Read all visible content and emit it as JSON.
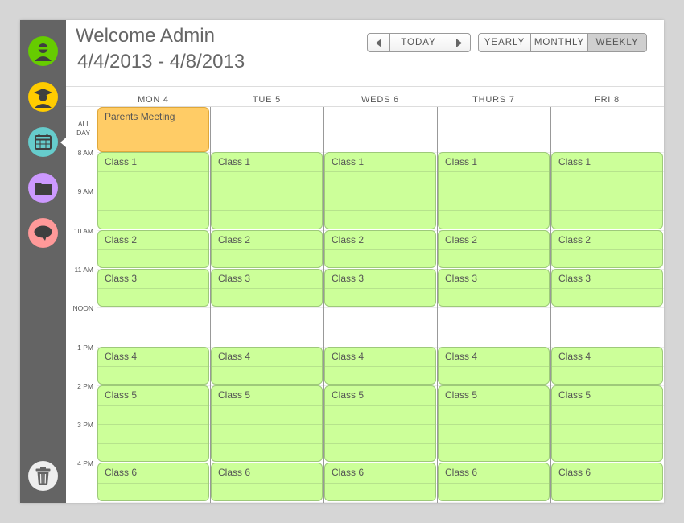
{
  "header": {
    "title": "Welcome Admin",
    "date_range": "4/4/2013 - 4/8/2013"
  },
  "nav": {
    "prev_icon": "triangle-left",
    "today_label": "TODAY",
    "next_icon": "triangle-right"
  },
  "views": [
    {
      "label": "YEARLY",
      "active": false
    },
    {
      "label": "MONTHLY",
      "active": false
    },
    {
      "label": "WEEKLY",
      "active": true
    }
  ],
  "sidebar": {
    "items": [
      {
        "icon": "user-icon",
        "color": "#66cc00"
      },
      {
        "icon": "graduate-icon",
        "color": "#ffcc00"
      },
      {
        "icon": "calendar-icon",
        "color": "#66cccc",
        "active": true
      },
      {
        "icon": "folder-icon",
        "color": "#cc99ff"
      },
      {
        "icon": "chat-icon",
        "color": "#ff9999"
      }
    ],
    "trash_icon": "trash-icon",
    "trash_color": "#eeeeee"
  },
  "days": [
    "MON 4",
    "TUE 5",
    "WEDS 6",
    "THURS 7",
    "FRI 8"
  ],
  "time_labels": [
    "ALL DAY",
    "8 AM",
    "9 AM",
    "10 AM",
    "11 AM",
    "NOON",
    "1 PM",
    "2 PM",
    "3 PM",
    "4 PM"
  ],
  "all_day_events": [
    {
      "day": 0,
      "title": "Parents Meeting",
      "color": "#ffcc66"
    }
  ],
  "classes": [
    {
      "title": "Class 1",
      "start": "8:00",
      "end": "10:00"
    },
    {
      "title": "Class 2",
      "start": "10:00",
      "end": "11:00"
    },
    {
      "title": "Class 3",
      "start": "11:00",
      "end": "12:00"
    },
    {
      "title": "Class 4",
      "start": "13:00",
      "end": "14:00"
    },
    {
      "title": "Class 5",
      "start": "14:00",
      "end": "16:00"
    },
    {
      "title": "Class 6",
      "start": "16:00",
      "end": "17:00"
    }
  ],
  "colors": {
    "class_fill": "#ccff99",
    "meeting_fill": "#ffcc66",
    "sidebar": "#646464"
  }
}
